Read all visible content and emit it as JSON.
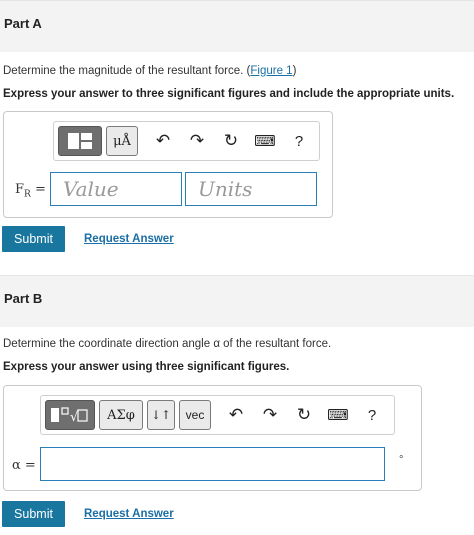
{
  "partA": {
    "title": "Part A",
    "prompt_text": "Determine the magnitude of the resultant force. (",
    "figure_link": "Figure 1",
    "prompt_close": ")",
    "instruction": "Express your answer to three significant figures and include the appropriate units.",
    "toolbar": {
      "template_button": "▣",
      "units_button": "μÅ",
      "undo": "↶",
      "redo": "↷",
      "reset": "↻",
      "keyboard": "⌨",
      "help": "?"
    },
    "var_label": "F",
    "var_sub": "R",
    "var_eq": " =",
    "value_placeholder": "Value",
    "units_placeholder": "Units",
    "submit": "Submit",
    "request": "Request Answer"
  },
  "partB": {
    "title": "Part B",
    "prompt_text": "Determine the coordinate direction angle α of the resultant force.",
    "instruction": "Express your answer using three significant figures.",
    "toolbar": {
      "template_button": "√□",
      "greek_button": "ΑΣφ",
      "arrows_button": "↓↑",
      "vec_button": "vec",
      "undo": "↶",
      "redo": "↷",
      "reset": "↻",
      "keyboard": "⌨",
      "help": "?"
    },
    "var_label": "α =",
    "unit": "°",
    "submit": "Submit",
    "request": "Request Answer"
  },
  "colors": {
    "accent": "#19769f",
    "link": "#1a6fa6",
    "input_border": "#2a7fb8",
    "header_bg": "#f3f3f3"
  }
}
